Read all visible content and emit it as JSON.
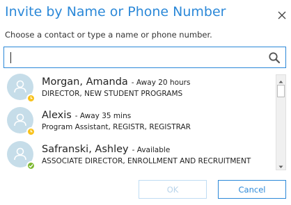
{
  "dialog": {
    "title": "Invite by Name or Phone Number",
    "subtitle": "Choose a contact or type a name or phone number."
  },
  "search": {
    "value": "",
    "placeholder": ""
  },
  "contacts": [
    {
      "name": "Morgan, Amanda",
      "status": "- Away 20 hours",
      "role": "DIRECTOR, NEW STUDENT PROGRAMS",
      "presence": "away",
      "presence_icon": "clock-icon",
      "presence_color": "#f8c21c"
    },
    {
      "name": "Alexis",
      "status": "- Away 35 mins",
      "role": "Program Assistant, REGISTR, REGISTRAR",
      "presence": "away",
      "presence_icon": "clock-icon",
      "presence_color": "#f8c21c"
    },
    {
      "name": "Safranski, Ashley",
      "status": "- Available",
      "role": "ASSOCIATE DIRECTOR, ENROLLMENT AND RECRUITMENT",
      "presence": "available",
      "presence_icon": "check-icon",
      "presence_color": "#7cb82f"
    }
  ],
  "buttons": {
    "ok_label": "OK",
    "cancel_label": "Cancel"
  },
  "colors": {
    "accent": "#2b88d8",
    "avatar_bg": "#c6dde9",
    "away": "#f8c21c",
    "available": "#7cb82f"
  }
}
